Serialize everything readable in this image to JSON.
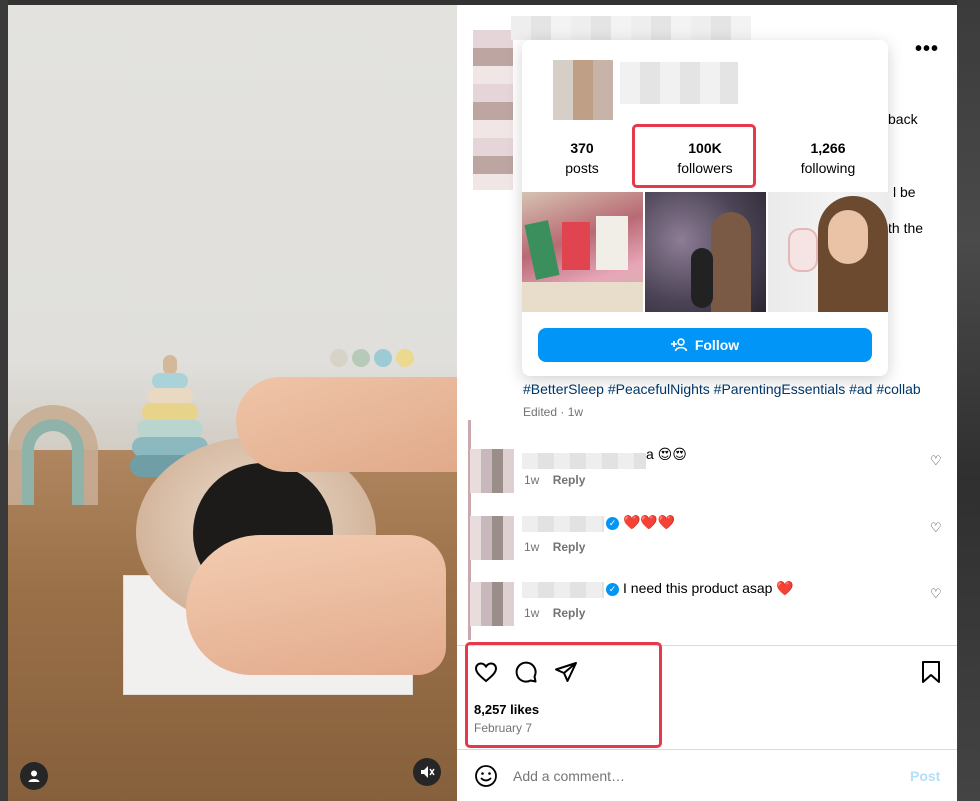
{
  "post": {
    "side_text_1": "back",
    "side_text_2": "l be",
    "side_text_3": "th the",
    "hashtags": "#BetterSleep #PeacefulNights #ParentingEssentials #ad #collab",
    "edited": "Edited · 1w"
  },
  "hover_card": {
    "stats": [
      {
        "value": "370",
        "label": "posts"
      },
      {
        "value": "100K",
        "label": "followers"
      },
      {
        "value": "1,266",
        "label": "following"
      }
    ],
    "follow_label": "Follow"
  },
  "comments": [
    {
      "text": "a 😍😍",
      "time": "1w",
      "reply": "Reply"
    },
    {
      "text": "❤️❤️❤️",
      "time": "1w",
      "reply": "Reply"
    },
    {
      "text": "I need this product asap ❤️",
      "time": "1w",
      "reply": "Reply"
    }
  ],
  "actions": {
    "likes": "8,257 likes",
    "date": "February 7"
  },
  "comment_box": {
    "placeholder": "Add a comment…",
    "post_label": "Post"
  },
  "colors": {
    "accent": "#0095f6",
    "highlight": "#e8384b",
    "hashtag": "#00376b"
  }
}
